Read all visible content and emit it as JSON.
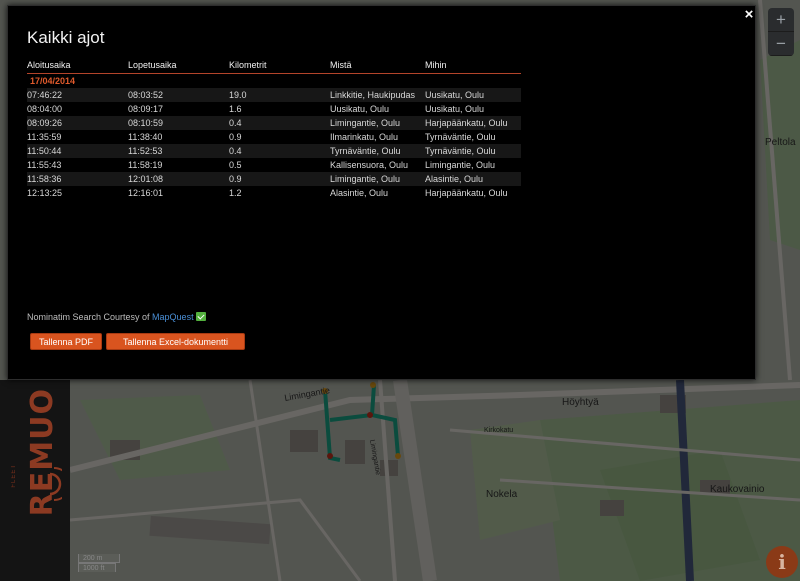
{
  "modal": {
    "title": "Kaikki ajot",
    "close_label": "×",
    "columns": [
      "Aloitusaika",
      "Lopetusaika",
      "Kilometrit",
      "Mistä",
      "Mihin"
    ],
    "date": "17/04/2014",
    "rows": [
      [
        "07:46:22",
        "08:03:52",
        "19.0",
        "Linkkitie, Haukipudas",
        "Uusikatu, Oulu"
      ],
      [
        "08:04:00",
        "08:09:17",
        "1.6",
        "Uusikatu, Oulu",
        "Uusikatu, Oulu"
      ],
      [
        "08:09:26",
        "08:10:59",
        "0.4",
        "Limingantie, Oulu",
        "Harjapäänkatu, Oulu"
      ],
      [
        "11:35:59",
        "11:38:40",
        "0.9",
        "Ilmarinkatu, Oulu",
        "Tyrnäväntie, Oulu"
      ],
      [
        "11:50:44",
        "11:52:53",
        "0.4",
        "Tyrnäväntie, Oulu",
        "Tyrnäväntie, Oulu"
      ],
      [
        "11:55:43",
        "11:58:19",
        "0.5",
        "Kallisensuora, Oulu",
        "Limingantie, Oulu"
      ],
      [
        "11:58:36",
        "12:01:08",
        "0.9",
        "Limingantie, Oulu",
        "Alasintie, Oulu"
      ],
      [
        "12:13:25",
        "12:16:01",
        "1.2",
        "Alasintie, Oulu",
        "Harjapäänkatu, Oulu"
      ]
    ],
    "credit_text": "Nominatim Search Courtesy of ",
    "credit_link": "MapQuest",
    "save_pdf_label": "Tallenna PDF",
    "save_excel_label": "Tallenna Excel-dokumentti"
  },
  "map": {
    "zoom_in": "+",
    "zoom_out": "−",
    "scale_metric": "200 m",
    "scale_imperial": "1000 ft",
    "labels": {
      "street_1": "Limingantie",
      "street_2": "Kirkokatu",
      "street_3": "Limingantie",
      "district_1": "Höyhtyä",
      "district_2": "Nokela",
      "district_3": "Kaukovainio",
      "top_right": "Peltola"
    },
    "info_label": "i"
  },
  "brand": {
    "name": "REMUO",
    "sub": "FLEET"
  },
  "colors": {
    "accent": "#d9541f",
    "date": "#e05a2c",
    "link": "#4a8fd6",
    "route": "#19a88a"
  }
}
